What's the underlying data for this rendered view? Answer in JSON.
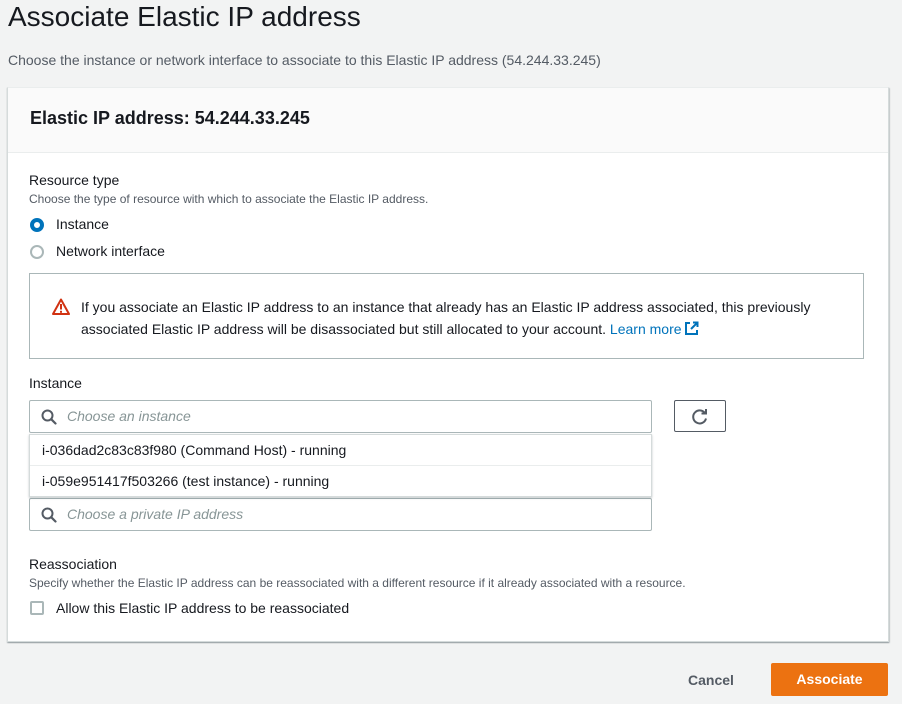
{
  "page": {
    "title": "Associate Elastic IP address",
    "description": "Choose the instance or network interface to associate to this Elastic IP address (54.244.33.245)"
  },
  "panel": {
    "title": "Elastic IP address: 54.244.33.245"
  },
  "resource_type": {
    "label": "Resource type",
    "description": "Choose the type of resource with which to associate the Elastic IP address.",
    "options": [
      {
        "label": "Instance",
        "selected": true
      },
      {
        "label": "Network interface",
        "selected": false
      }
    ]
  },
  "alert": {
    "text": "If you associate an Elastic IP address to an instance that already has an Elastic IP address associated, this previously associated Elastic IP address will be disassociated but still allocated to your account.",
    "link_label": "Learn more",
    "icon": "warning-icon",
    "icon_color": "#d13212"
  },
  "instance": {
    "label": "Instance",
    "placeholder": "Choose an instance",
    "options": [
      "i-036dad2c83c83f980 (Command Host) - running",
      "i-059e951417f503266 (test instance) - running"
    ]
  },
  "private_ip": {
    "placeholder": "Choose a private IP address"
  },
  "reassociation": {
    "label": "Reassociation",
    "description": "Specify whether the Elastic IP address can be reassociated with a different resource if it already associated with a resource.",
    "checkbox_label": "Allow this Elastic IP address to be reassociated",
    "checked": false
  },
  "actions": {
    "cancel_label": "Cancel",
    "submit_label": "Associate"
  },
  "colors": {
    "primary": "#ec7211",
    "link": "#0073bb",
    "radio_selected": "#0073bb"
  }
}
